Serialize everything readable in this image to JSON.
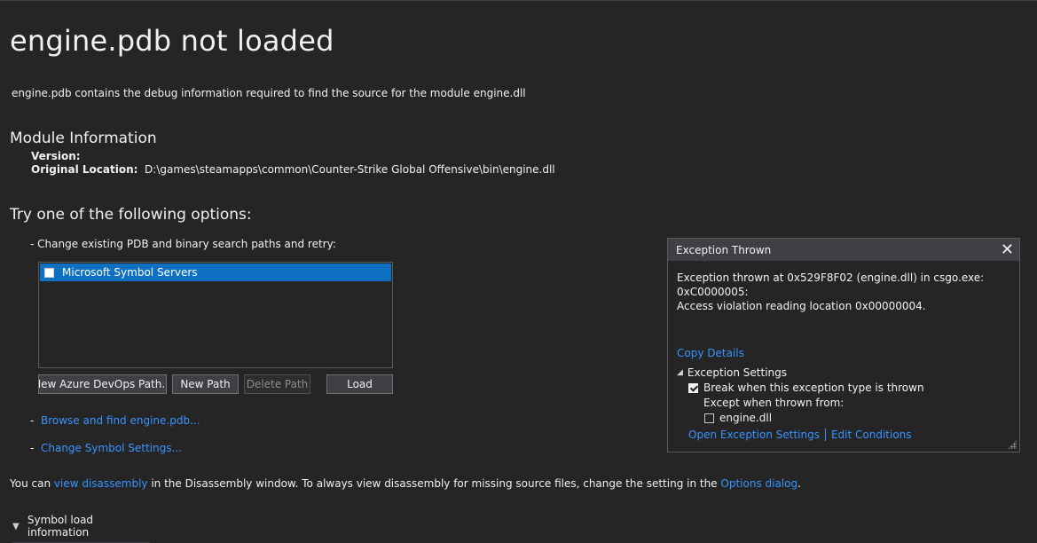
{
  "page": {
    "title": "engine.pdb not loaded",
    "description": "engine.pdb contains the debug information required to find the source for the module engine.dll"
  },
  "module_info": {
    "heading": "Module Information",
    "version_label": "Version:",
    "version_value": "",
    "location_label": "Original Location:",
    "location_value": "D:\\games\\steamapps\\common\\Counter-Strike Global Offensive\\bin\\engine.dll"
  },
  "options": {
    "heading": "Try one of the following options:",
    "change_paths": "-  Change existing PDB and binary search paths and retry:",
    "list_items": [
      "Microsoft Symbol Servers"
    ],
    "buttons": {
      "azure": "New Azure DevOps Path...",
      "new_path": "New Path",
      "delete_path": "Delete Path",
      "load": "Load"
    },
    "dash": "-",
    "browse": "Browse and find engine.pdb...",
    "change_symbol": "Change Symbol Settings..."
  },
  "footer": {
    "prefix": "You can ",
    "view_disasm": "view disassembly",
    "middle": " in the Disassembly window. To always view disassembly for missing source files, change the setting in the ",
    "options_dialog": "Options dialog",
    "suffix": "."
  },
  "symbol_info": "Symbol load information",
  "exception": {
    "title": "Exception Thrown",
    "message_line1": "Exception thrown at 0x529F8F02 (engine.dll) in csgo.exe: 0xC0000005:",
    "message_line2": "Access violation reading location 0x00000004.",
    "copy_details": "Copy Details",
    "settings_label": "Exception Settings",
    "break_when": "Break when this exception type is thrown",
    "break_checked": true,
    "except_when": "Except when thrown from:",
    "dll_item": "engine.dll",
    "dll_checked": false,
    "open_settings": "Open Exception Settings",
    "edit_conditions": "Edit Conditions"
  },
  "colors": {
    "background": "#252526",
    "link": "#3794ff",
    "selection": "#0e70c0"
  }
}
